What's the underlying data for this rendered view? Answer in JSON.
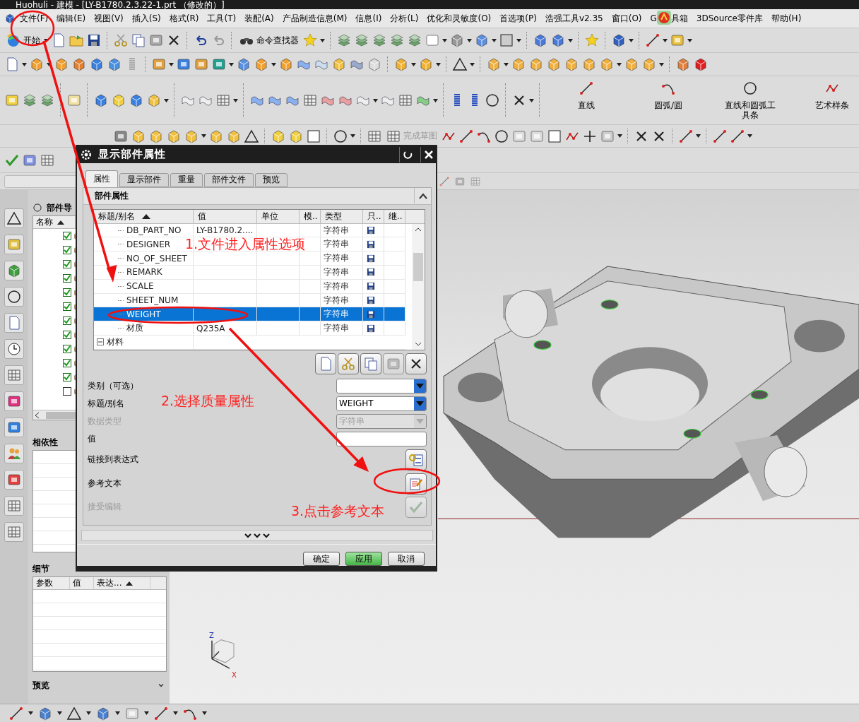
{
  "window": {
    "title": "Huohuli - 建模 - [LY-B1780.2.3.22-1.prt （修改的）]"
  },
  "menu": [
    {
      "label": "文件(F)"
    },
    {
      "label": "编辑(E)"
    },
    {
      "label": "视图(V)"
    },
    {
      "label": "插入(S)"
    },
    {
      "label": "格式(R)"
    },
    {
      "label": "工具(T)"
    },
    {
      "label": "装配(A)"
    },
    {
      "label": "产品制造信息(M)"
    },
    {
      "label": "信息(I)"
    },
    {
      "label": "分析(L)"
    },
    {
      "label": "优化和灵敏度(O)"
    },
    {
      "label": "首选项(P)"
    },
    {
      "label": "浩强工具v2.35"
    },
    {
      "label": "窗口(O)"
    },
    {
      "label": "G",
      "label_after_badge": "具箱"
    },
    {
      "label": "3DSource零件库"
    },
    {
      "label": "帮助(H)"
    }
  ],
  "toolbar": {
    "start_label": "开始",
    "finder_label": "命令查找器"
  },
  "curve_toolbar": [
    {
      "label": "直线",
      "kind": "line"
    },
    {
      "label": "圆弧/圆",
      "kind": "arc"
    },
    {
      "label": "直线和圆弧工具条",
      "kind": "combo"
    },
    {
      "label": "艺术样条",
      "kind": "spline"
    }
  ],
  "sketch_toolbar": {
    "finish_label": "完成草图"
  },
  "part_navigator": {
    "title": "部件导",
    "column": "名称",
    "rows": [
      {
        "checked": true
      },
      {
        "checked": true
      },
      {
        "checked": true
      },
      {
        "checked": true
      },
      {
        "checked": true
      },
      {
        "checked": true
      },
      {
        "checked": true
      },
      {
        "checked": true
      },
      {
        "checked": true
      },
      {
        "checked": true
      },
      {
        "checked": true
      },
      {
        "checked": false
      }
    ]
  },
  "dependencies": {
    "title": "相依性"
  },
  "details": {
    "title": "细节",
    "columns": [
      "参数",
      "值",
      "表达..."
    ]
  },
  "preview": {
    "title": "预览"
  },
  "dialog": {
    "title": "显示部件属性",
    "tabs": [
      {
        "label": "属性",
        "selected": true
      },
      {
        "label": "显示部件",
        "selected": false
      },
      {
        "label": "重量",
        "selected": false
      },
      {
        "label": "部件文件",
        "selected": false
      },
      {
        "label": "预览",
        "selected": false
      }
    ],
    "section": "部件属性",
    "columns": [
      "标题/别名",
      "值",
      "单位",
      "模..",
      "类型",
      "只..",
      "继.."
    ],
    "rows": [
      {
        "title": "DB_PART_NO",
        "value": "LY-B1780.2....",
        "type": "字符串",
        "selected": false
      },
      {
        "title": "DESIGNER",
        "type": "字符串",
        "selected": false
      },
      {
        "title": "NO_OF_SHEET",
        "type": "字符串",
        "selected": false
      },
      {
        "title": "REMARK",
        "type": "字符串",
        "selected": false
      },
      {
        "title": "SCALE",
        "type": "字符串",
        "selected": false
      },
      {
        "title": "SHEET_NUM",
        "type": "字符串",
        "selected": false
      },
      {
        "title": "WEIGHT",
        "type": "字符串",
        "selected": true
      },
      {
        "title": "材质",
        "value": "Q235A",
        "type": "字符串",
        "selected": false
      }
    ],
    "group_row": "材料",
    "form": [
      {
        "label": "类别（可选）",
        "kind": "dropdown",
        "disabled": false
      },
      {
        "label": "标题/别名",
        "kind": "dropdown",
        "value": "WEIGHT",
        "disabled": false
      },
      {
        "label": "数据类型",
        "kind": "dropdown",
        "value": "字符串",
        "disabled": true
      },
      {
        "label": "值",
        "kind": "text",
        "disabled": false
      },
      {
        "label": "链接到表达式",
        "kind": "link",
        "disabled": false
      },
      {
        "label": "参考文本",
        "kind": "edit",
        "disabled": false
      },
      {
        "label": "接受编辑",
        "kind": "accept",
        "disabled": true
      }
    ],
    "buttons": [
      {
        "label": "确定",
        "kind": "normal"
      },
      {
        "label": "应用",
        "kind": "primary"
      },
      {
        "label": "取消",
        "kind": "normal"
      }
    ]
  },
  "annotations": [
    {
      "text": "1.文件进入属性选项"
    },
    {
      "text": "2.选择质量属性"
    },
    {
      "text": "3.点击参考文本"
    }
  ],
  "view": {
    "axis_labels": [
      "Z",
      "X"
    ]
  }
}
